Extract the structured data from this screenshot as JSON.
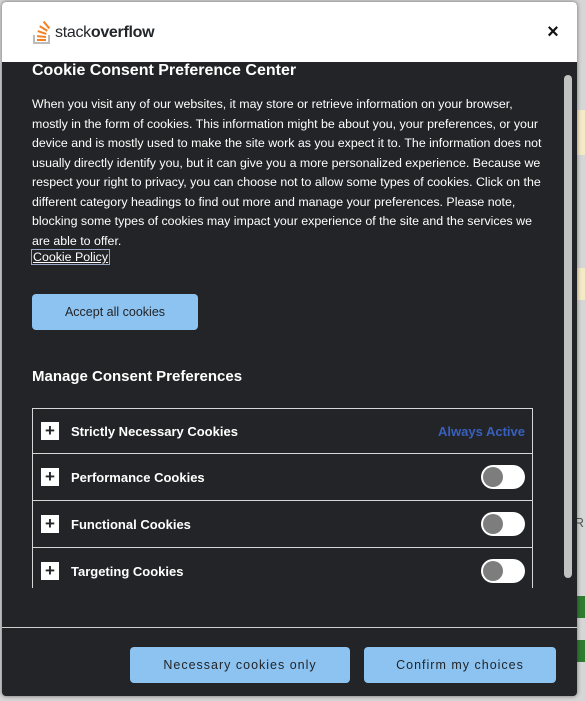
{
  "header": {
    "logo_light": "stack",
    "logo_bold": "overflow",
    "close_label": "×"
  },
  "consent": {
    "title": "Cookie Consent Preference Center",
    "description": "When you visit any of our websites, it may store or retrieve information on your browser, mostly in the form of cookies. This information might be about you, your preferences, or your device and is mostly used to make the site work as you expect it to. The information does not usually directly identify you, but it can give you a more personalized experience. Because we respect your right to privacy, you can choose not to allow some types of cookies. Click on the different category headings to find out more and manage your preferences. Please note, blocking some types of cookies may impact your experience of the site and the services we are able to offer.",
    "policy_link": "Cookie Policy",
    "accept_all": "Accept all cookies",
    "manage_title": "Manage Consent Preferences",
    "categories": [
      {
        "label": "Strictly Necessary Cookies",
        "status": "Always Active"
      },
      {
        "label": "Performance Cookies",
        "enabled": false
      },
      {
        "label": "Functional Cookies",
        "enabled": false
      },
      {
        "label": "Targeting Cookies",
        "enabled": false
      }
    ]
  },
  "footer": {
    "necessary_only": "Necessary cookies only",
    "confirm": "Confirm my choices"
  },
  "background": {
    "edge_letter": "R"
  },
  "colors": {
    "modal_bg": "#232427",
    "button_bg": "#8cc3f1",
    "always_active": "#3860be",
    "logo_orange": "#f48024"
  }
}
